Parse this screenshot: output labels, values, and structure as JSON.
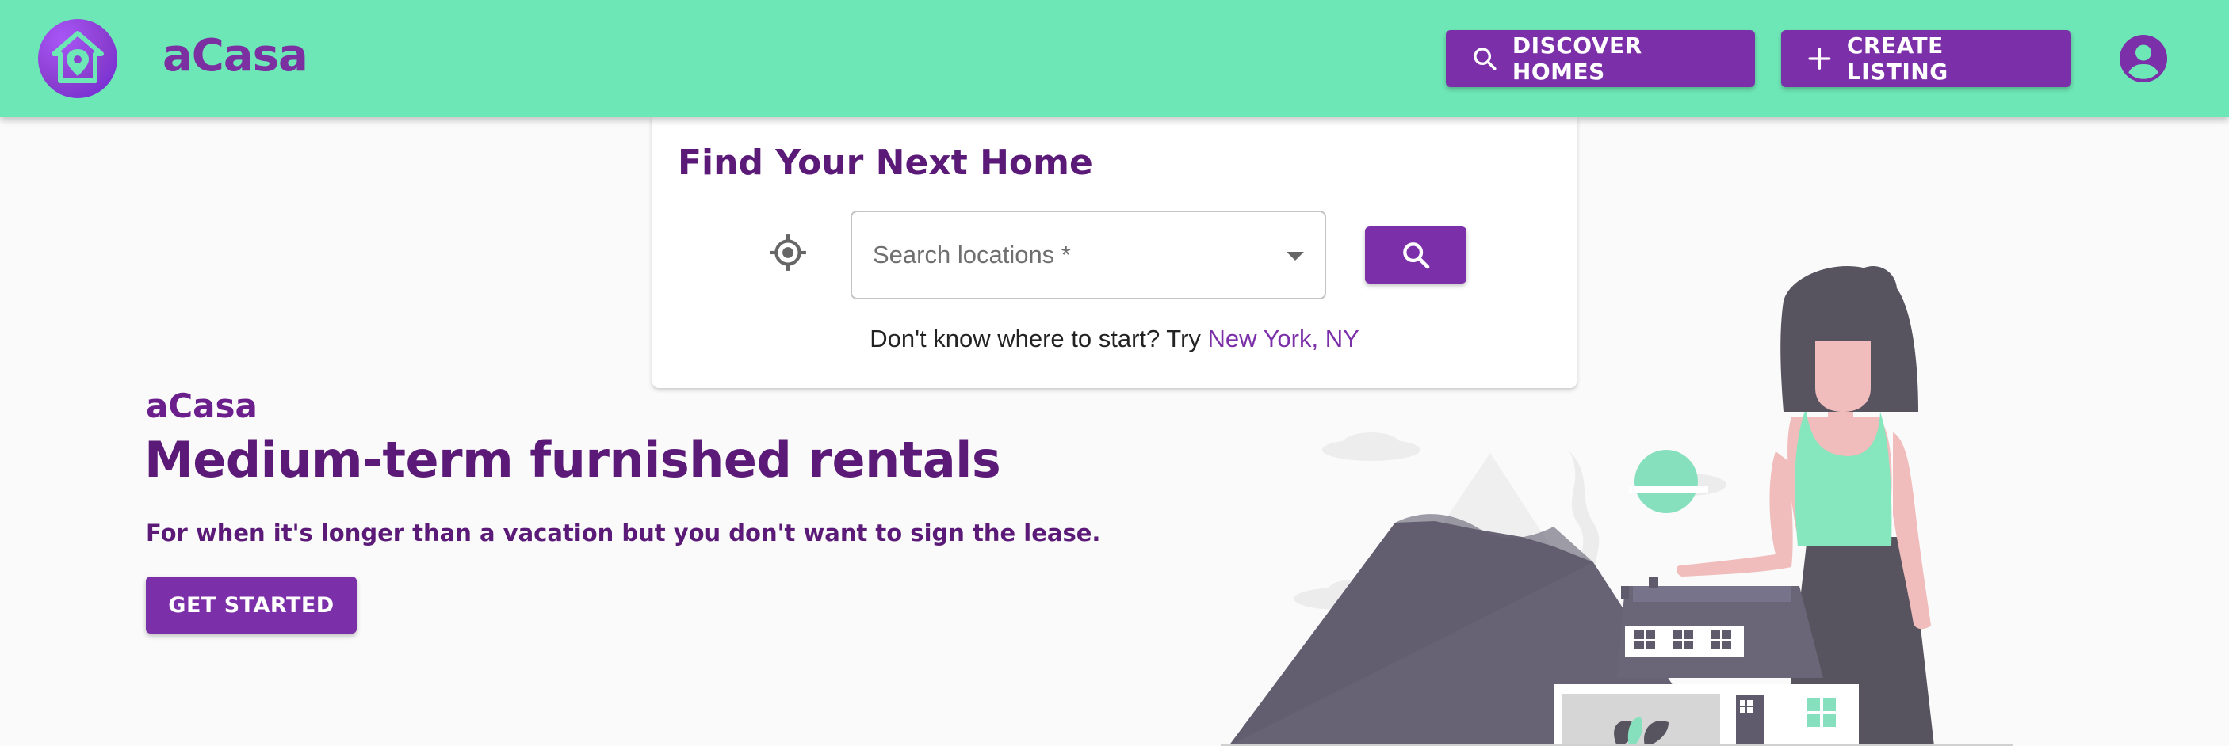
{
  "header": {
    "brand": "aCasa",
    "discover_label": "DISCOVER HOMES",
    "create_label": "CREATE LISTING",
    "logo_icon": "home-pin-icon",
    "account_icon": "account-circle-icon"
  },
  "search": {
    "title": "Find Your Next Home",
    "placeholder": "Search locations *",
    "hint_prefix": "Don't know where to start? Try ",
    "hint_link": "New York, NY"
  },
  "hero": {
    "brand": "aCasa",
    "title": "Medium-term furnished rentals",
    "subtitle": "For when it's longer than a vacation but you don't want to sign the lease.",
    "cta_label": "GET STARTED"
  },
  "colors": {
    "header_bg": "#6ee7b7",
    "primary": "#7b2fa8",
    "heading": "#5b1a77"
  }
}
